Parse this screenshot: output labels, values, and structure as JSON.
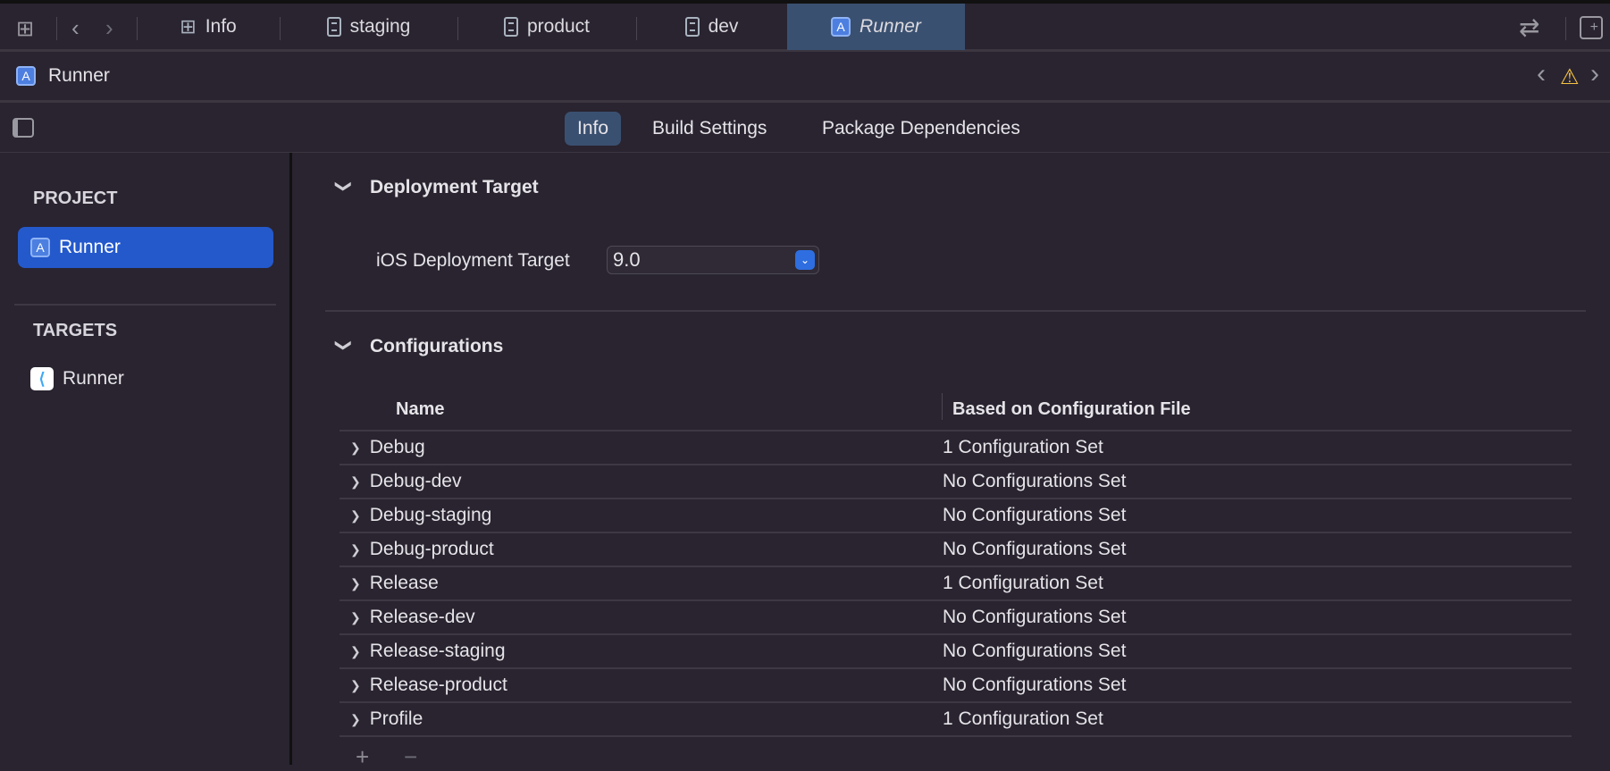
{
  "tabs": [
    {
      "label": "Info",
      "icon": "table-icon"
    },
    {
      "label": "staging",
      "icon": "document-icon"
    },
    {
      "label": "product",
      "icon": "document-icon"
    },
    {
      "label": "dev",
      "icon": "document-icon"
    },
    {
      "label": "Runner",
      "icon": "app-project-icon",
      "active": true
    }
  ],
  "path": {
    "title": "Runner"
  },
  "editor_tabs": [
    {
      "label": "Info",
      "active": true
    },
    {
      "label": "Build Settings"
    },
    {
      "label": "Package Dependencies"
    }
  ],
  "sidebar": {
    "project_header": "PROJECT",
    "project_item": "Runner",
    "targets_header": "TARGETS",
    "target_item": "Runner"
  },
  "deployment": {
    "title": "Deployment Target",
    "label": "iOS Deployment Target",
    "value": "9.0"
  },
  "configurations": {
    "title": "Configurations",
    "col_name": "Name",
    "col_file": "Based on Configuration File",
    "rows": [
      {
        "name": "Debug",
        "file": "1 Configuration Set"
      },
      {
        "name": "Debug-dev",
        "file": "No Configurations Set"
      },
      {
        "name": "Debug-staging",
        "file": "No Configurations Set"
      },
      {
        "name": "Debug-product",
        "file": "No Configurations Set"
      },
      {
        "name": "Release",
        "file": "1 Configuration Set"
      },
      {
        "name": "Release-dev",
        "file": "No Configurations Set"
      },
      {
        "name": "Release-staging",
        "file": "No Configurations Set"
      },
      {
        "name": "Release-product",
        "file": "No Configurations Set"
      },
      {
        "name": "Profile",
        "file": "1 Configuration Set"
      }
    ],
    "add": "+",
    "remove": "−"
  },
  "colors": {
    "accent": "#2459cc",
    "tab_active": "#3a5070",
    "warning": "#f5c242"
  }
}
